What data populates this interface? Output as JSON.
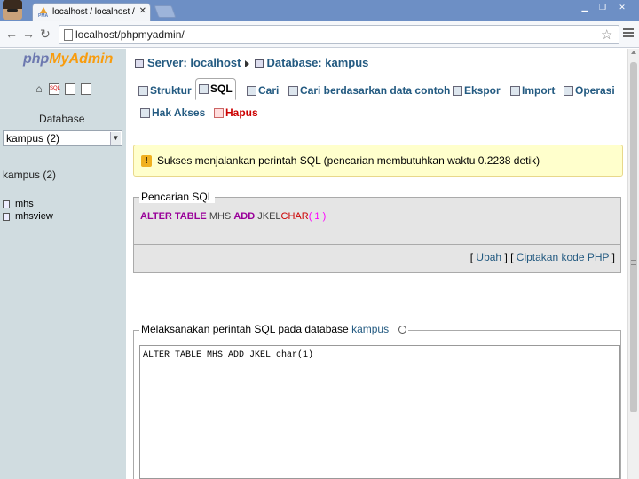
{
  "browser": {
    "tab_title": "localhost / localhost / kampus",
    "url": "localhost/phpmyadmin/"
  },
  "nav": {
    "logo_php": "php",
    "logo_my": "My",
    "logo_admin": "Admin",
    "database_label": "Database",
    "database_select": "kampus (2)",
    "db_heading": "kampus (2)",
    "tables": [
      "mhs",
      "mhsview"
    ]
  },
  "breadcrumb": {
    "server": "Server: localhost",
    "database": "Database: kampus"
  },
  "tabs": {
    "struktur": "Struktur",
    "sql": "SQL",
    "cari": "Cari",
    "cari_data": "Cari berdasarkan data contoh",
    "ekspor": "Ekspor",
    "import": "Import",
    "operasi": "Operasi",
    "hak_akses": "Hak Akses",
    "hapus": "Hapus"
  },
  "notice": {
    "message": "Sukses menjalankan perintah SQL (pencarian membutuhkan waktu 0.2238 detik)"
  },
  "sql_query": {
    "legend": "Pencarian SQL",
    "kw1": "ALTER TABLE",
    "table": "MHS",
    "kw2": "ADD",
    "column": "JKEL",
    "type": "CHAR",
    "args": "( 1 )",
    "links": {
      "open": "[",
      "ubah": "Ubah",
      "middle": "] [",
      "php": "Ciptakan kode PHP",
      "close": "]"
    }
  },
  "run_sql": {
    "legend_prefix": "Melaksanakan perintah SQL pada database",
    "db_link": "kampus",
    "textarea": "ALTER TABLE MHS ADD JKEL char(1)"
  }
}
